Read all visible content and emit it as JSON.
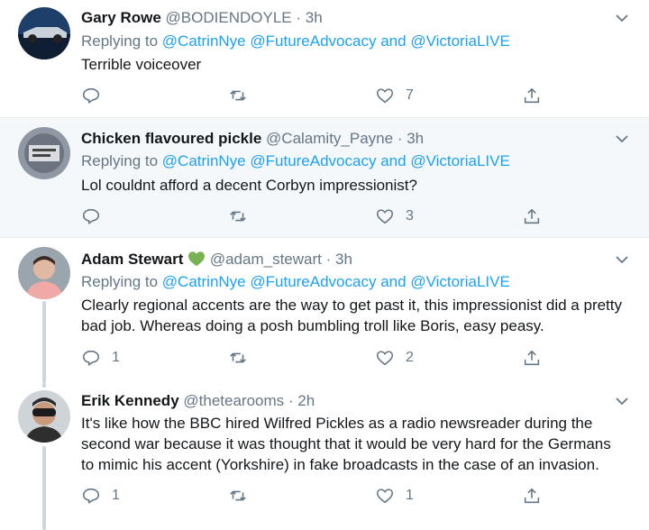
{
  "tweets": [
    {
      "name": "Gary Rowe",
      "handle": "@BODIENDOYLE",
      "time": "3h",
      "replying_label": "Replying to",
      "mentions": [
        "@CatrinNye",
        "@FutureAdvocacy",
        "@VictoriaLIVE"
      ],
      "conjunction": "and",
      "text": "Terrible voiceover",
      "replies": "",
      "retweets": "",
      "likes": "7"
    },
    {
      "name": "Chicken flavoured pickle",
      "handle": "@Calamity_Payne",
      "time": "3h",
      "replying_label": "Replying to",
      "mentions": [
        "@CatrinNye",
        "@FutureAdvocacy",
        "@VictoriaLIVE"
      ],
      "conjunction": "and",
      "text": "Lol couldnt afford a decent Corbyn impressionist?",
      "replies": "",
      "retweets": "",
      "likes": "3"
    },
    {
      "name": "Adam Stewart",
      "handle": "@adam_stewart",
      "time": "3h",
      "replying_label": "Replying to",
      "mentions": [
        "@CatrinNye",
        "@FutureAdvocacy",
        "@VictoriaLIVE"
      ],
      "conjunction": "and",
      "text_lines": [
        "Clearly regional accents are the way to get past it, this impressionist did a pretty",
        "bad job. Whereas doing a posh bumbling troll like Boris, easy peasy."
      ],
      "replies": "1",
      "retweets": "",
      "likes": "2"
    },
    {
      "name": "Erik Kennedy",
      "handle": "@thetearooms",
      "time": "2h",
      "text_lines": [
        "It's like how the BBC hired Wilfred Pickles as a radio newsreader during the",
        "second war because it was thought that it would be very hard for the Germans",
        "to mimic his accent (Yorkshire) in fake broadcasts in the case of an invasion."
      ],
      "replies": "1",
      "retweets": "",
      "likes": "1"
    }
  ],
  "separator": "·",
  "colors": {
    "link": "#1da1f2",
    "muted": "#657786",
    "heart_emoji": "#77b255"
  }
}
